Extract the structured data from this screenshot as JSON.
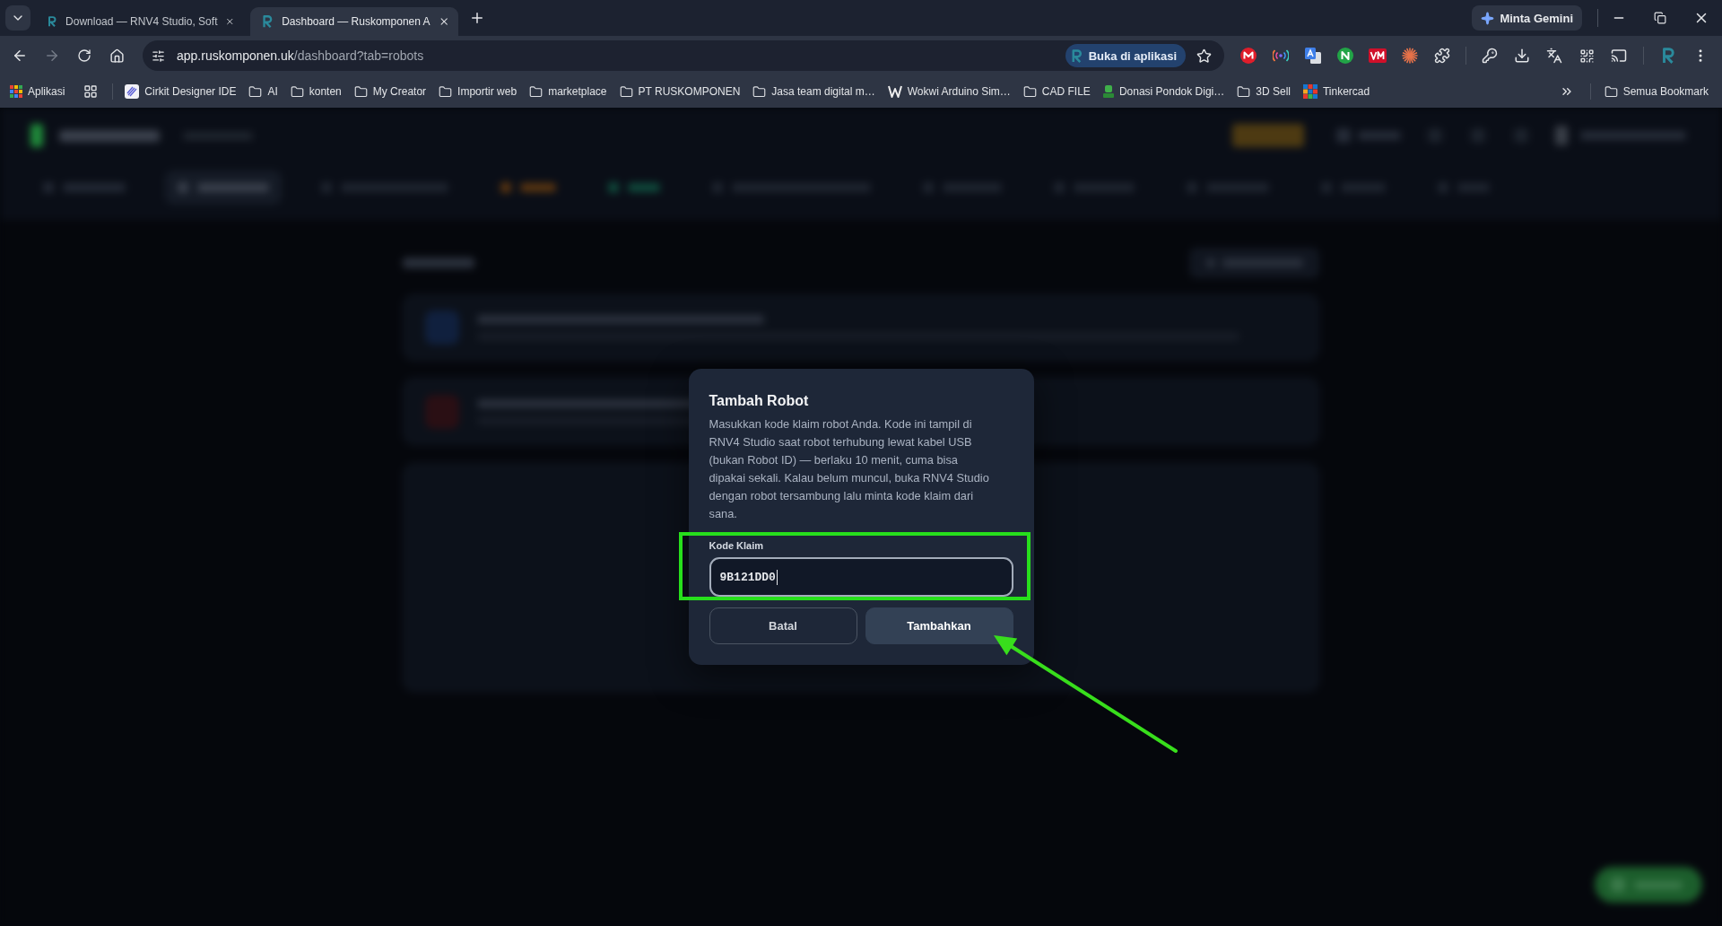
{
  "browser": {
    "tabs": [
      {
        "title": "Download — RNV4 Studio, Soft",
        "selected": false
      },
      {
        "title": "Dashboard — Ruskomponen A",
        "selected": true
      }
    ],
    "gemini_button": "Minta Gemini",
    "address_bar": {
      "host": "app.ruskomponen.uk",
      "path": "/dashboard?tab=robots"
    },
    "open_in_app_button": "Buka di aplikasi",
    "bookmarks": [
      {
        "label": "Aplikasi",
        "kind": "apps"
      },
      {
        "label": "Cirkit Designer IDE",
        "kind": "pen"
      },
      {
        "label": "AI",
        "kind": "folder"
      },
      {
        "label": "konten",
        "kind": "folder"
      },
      {
        "label": "My Creator",
        "kind": "folder"
      },
      {
        "label": "Importir web",
        "kind": "folder"
      },
      {
        "label": "marketplace",
        "kind": "folder"
      },
      {
        "label": "PT RUSKOMPONEN",
        "kind": "folder"
      },
      {
        "label": "Jasa team digital m…",
        "kind": "folder"
      },
      {
        "label": "Wokwi Arduino Sim…",
        "kind": "zigzag"
      },
      {
        "label": "CAD FILE",
        "kind": "folder"
      },
      {
        "label": "Donasi Pondok Digi…",
        "kind": "figure"
      },
      {
        "label": "3D Sell",
        "kind": "folder"
      },
      {
        "label": "Tinkercad",
        "kind": "blocks"
      }
    ],
    "all_bookmarks": "Semua Bookmark"
  },
  "dialog": {
    "title": "Tambah Robot",
    "description": "Masukkan kode klaim robot Anda. Kode ini tampil di RNV4 Studio saat robot terhubung lewat kabel USB (bukan Robot ID) — berlaku 10 menit, cuma bisa dipakai sekali. Kalau belum muncul, buka RNV4 Studio dengan robot tersambung lalu minta kode klaim dari sana.",
    "field": {
      "label": "Kode Klaim",
      "value": "9B121DD0",
      "focused": true
    },
    "buttons": [
      {
        "label": "Batal",
        "kind": "secondary"
      },
      {
        "label": "Tambahkan",
        "kind": "primary"
      }
    ]
  }
}
